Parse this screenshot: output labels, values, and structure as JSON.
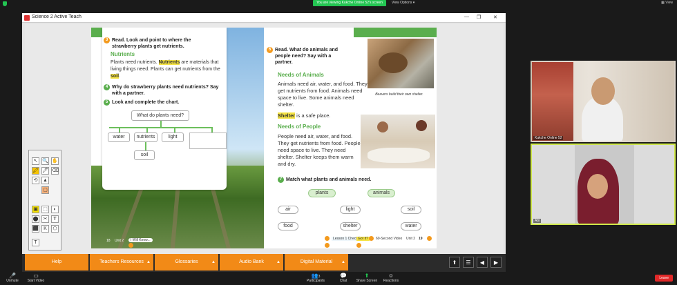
{
  "zoom": {
    "share_banner": "You are viewing Kukche Online 52's screen",
    "view_options": "View Options ▾",
    "view_top_right": "▦ View",
    "toolbar": [
      {
        "label": "Unmute",
        "icon": "mic-muted-icon"
      },
      {
        "label": "Start Video",
        "icon": "video-off-icon"
      },
      {
        "label": "Participants",
        "icon": "participants-icon",
        "count": "3"
      },
      {
        "label": "Chat",
        "icon": "chat-icon"
      },
      {
        "label": "Share Screen",
        "icon": "share-screen-icon"
      },
      {
        "label": "Reactions",
        "icon": "reactions-icon"
      }
    ],
    "leave": "Leave",
    "participants": [
      {
        "name": "Kukche Online 52"
      },
      {
        "name": "Abi"
      }
    ],
    "colors": {
      "share": "#23c552",
      "leave": "#e02828",
      "active_speaker": "#cfe84a"
    }
  },
  "window": {
    "title": "Science 2 Active Teach",
    "controls": [
      "—",
      "❐",
      "✕"
    ]
  },
  "left_page": {
    "q3_num": "3",
    "q3_text": "Read. Look and point to where the strawberry plants get nutrients.",
    "heading": "Nutrients",
    "para_1": "Plants need nutrients.",
    "para_hl": "Nutrients",
    "para_2": "are materials that living things need. Plants can get nutrients from the",
    "para_hl2": "soil",
    "q4_num": "4",
    "q4_text": "Why do strawberry plants need nutrients? Say with a partner.",
    "q5_num": "5",
    "q5_text": "Look and complete the chart.",
    "chart_question": "What do plants need?",
    "chart_items": [
      "water",
      "nutrients",
      "light"
    ],
    "chart_bottom": "soil",
    "footer_page": "18",
    "footer_unit": "Unit 2",
    "footer_tag": "I Will Know..."
  },
  "right_page": {
    "q6_num": "6",
    "q6_text": "Read. What do animals and people need? Say with a partner.",
    "heading_animals": "Needs of Animals",
    "animals_text": "Animals need air, water, and food. They get nutrients from food. Animals need space to live. Some animals need shelter.",
    "shelter_hl": "Shelter",
    "shelter_text": "is a safe place.",
    "caption": "Beavers build their own shelter.",
    "heading_people": "Needs of People",
    "people_text": "People need air, water, and food. They get nutrients from food. People need space to live. They need shelter. Shelter keeps them warm and dry.",
    "q7_num": "7",
    "q7_text": "Match what plants and animals need.",
    "match_headers": [
      "plants",
      "animals"
    ],
    "match_words": [
      "air",
      "light",
      "soil",
      "food",
      "shelter",
      "water"
    ],
    "footer_lesson": "Lesson 1 Check",
    "footer_gotit": "Got It?",
    "footer_video": "60-Second Video",
    "footer_unit": "Unit 2",
    "footer_page": "19"
  },
  "menu": {
    "tabs": [
      "Help",
      "Teachers Resources",
      "Glossaries",
      "Audio Bank",
      "Digital Material"
    ],
    "tab_arrow": "▲",
    "nav": [
      "⬆",
      "☰",
      "◀",
      "▶"
    ]
  },
  "palette": {
    "tools": [
      "↖",
      "🔍",
      "✋",
      "🖍",
      "🖊",
      "⌫",
      "⟲",
      "▲",
      "▢",
      "▣",
      "⬚",
      "◐",
      "⬤",
      "✂",
      "T",
      "⬛",
      "K",
      "⬡",
      "T"
    ]
  }
}
